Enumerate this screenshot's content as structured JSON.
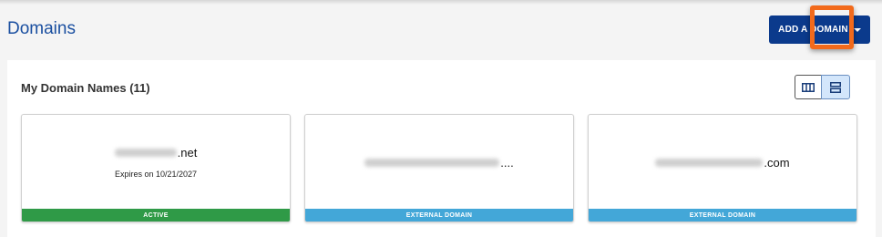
{
  "header": {
    "title": "Domains",
    "add_button_label": "ADD A DOMAIN"
  },
  "panel": {
    "title": "My Domain Names (11)"
  },
  "view_toggle": {
    "grid_icon": "columns-view-icon",
    "list_icon": "rows-view-icon",
    "active": "list"
  },
  "colors": {
    "brand": "#0b3a8c",
    "title_blue": "#1a4fa0",
    "active_status": "#2f9a47",
    "external_status": "#43a7d8",
    "highlight": "#f26a1b"
  },
  "cards": [
    {
      "domain_suffix": ".net",
      "expires": "Expires on 10/21/2027",
      "status": "ACTIVE"
    },
    {
      "domain_suffix": "....",
      "expires": "",
      "status": "EXTERNAL DOMAIN"
    },
    {
      "domain_suffix": ".com",
      "expires": "",
      "status": "EXTERNAL DOMAIN"
    }
  ]
}
